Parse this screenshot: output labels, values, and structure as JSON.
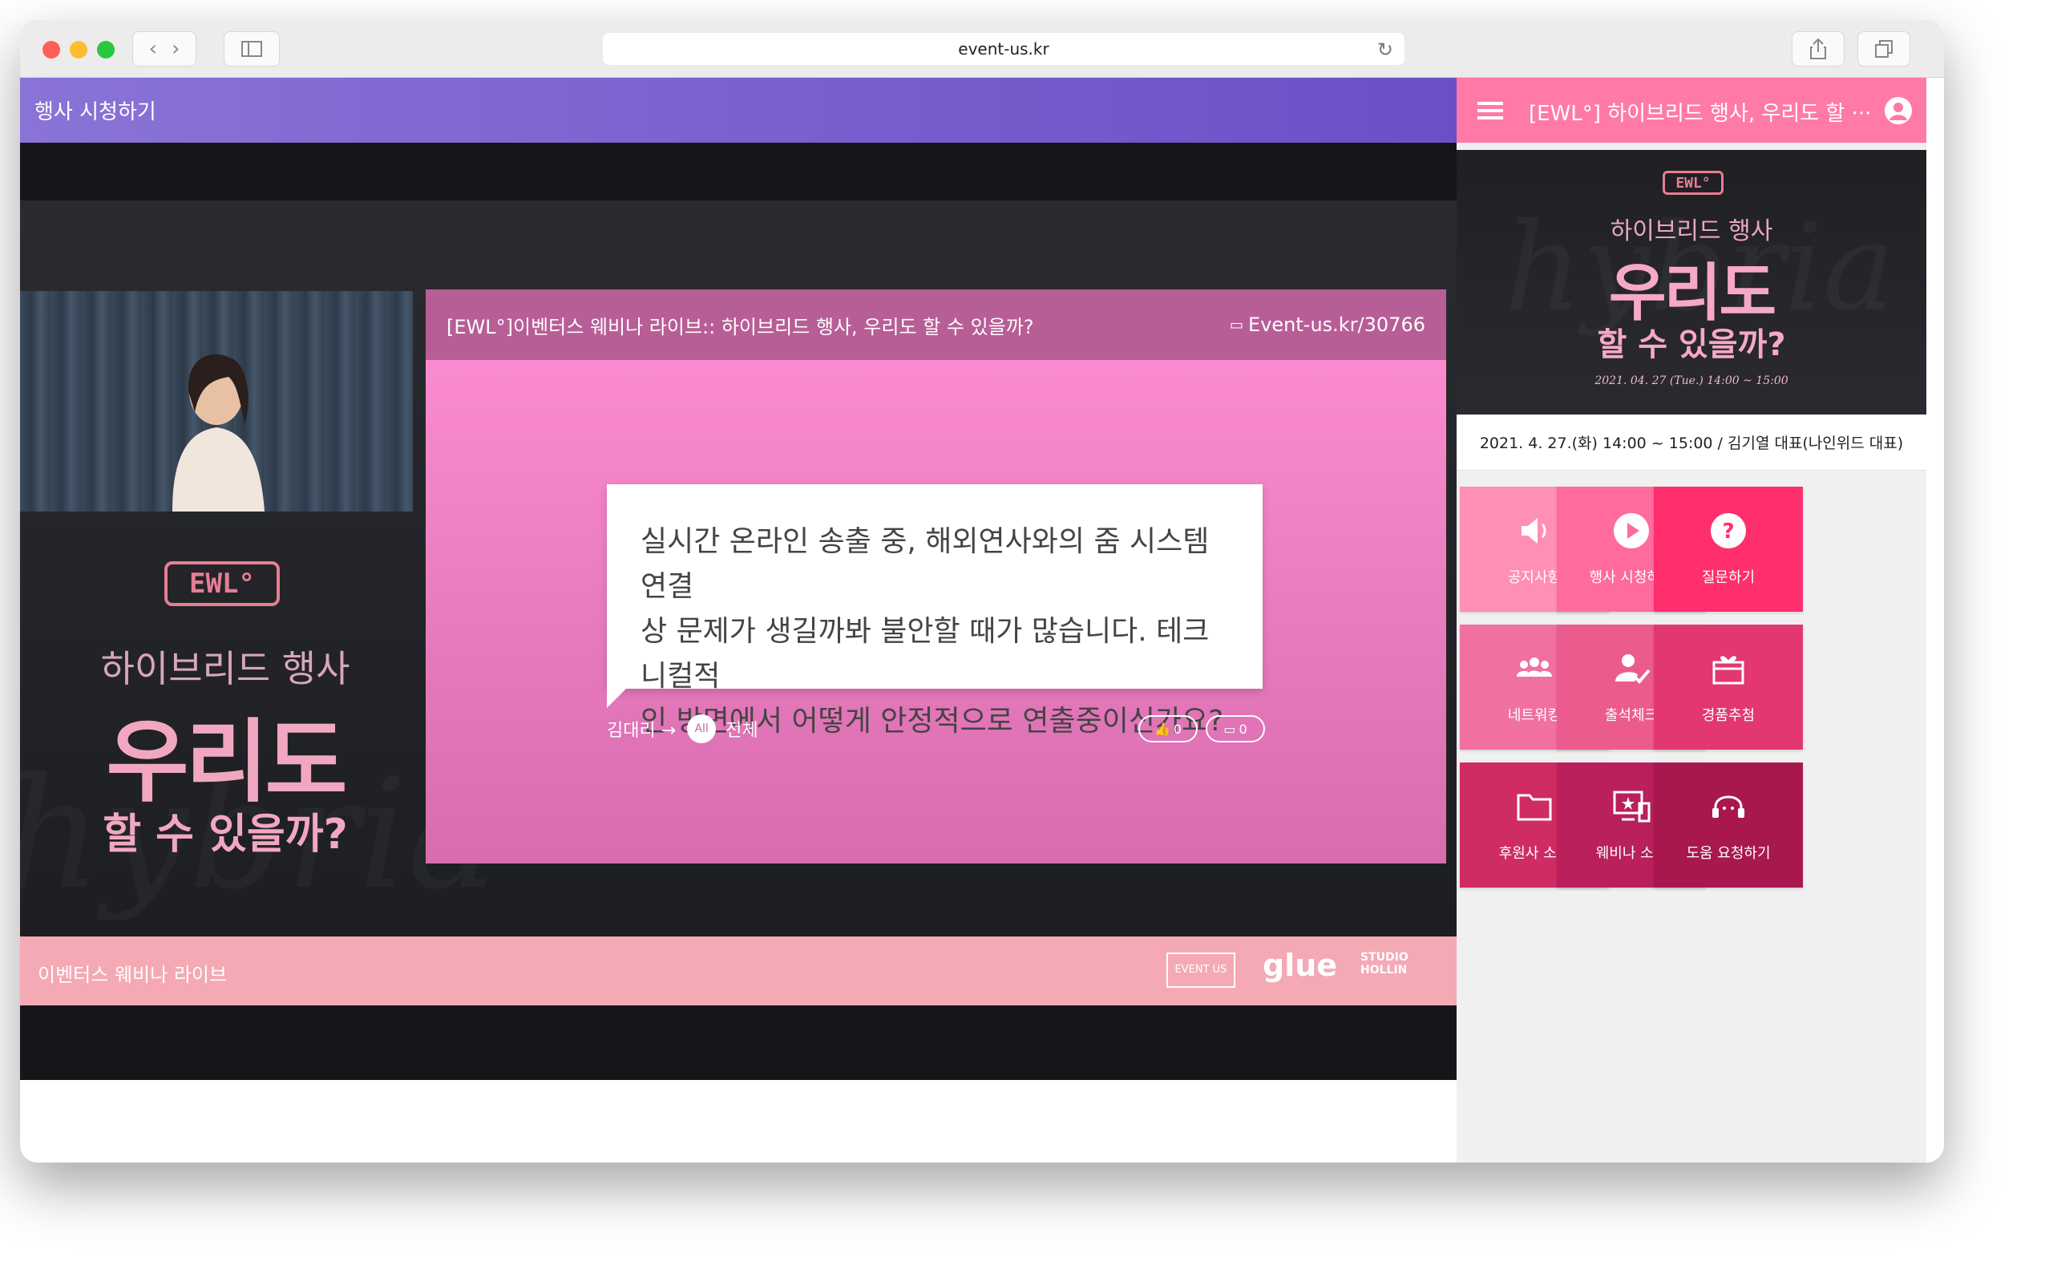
{
  "browser": {
    "url": "event-us.kr"
  },
  "main": {
    "header_title": "행사 시청하기",
    "slide": {
      "title": "[EWL°]이벤터스 웨비나 라이브:: 하이브리드 행사, 우리도 할 수 있을까?",
      "url_label": "Event-us.kr/30766",
      "question_lines": [
        "실시간 온라인 송출 중, 해외연사와의 줌 시스템 연결",
        "상 문제가 생길까봐 불안할 때가 많습니다. 테크니컬적",
        "인 방면에서 어떻게 안정적으로 연출중이신가요?"
      ],
      "asker": "김대리 →",
      "target_badge": "All",
      "target_label": "전체",
      "likes": "0",
      "comments": "0"
    },
    "left_panel": {
      "logo": "EWL°",
      "sub": "하이브리드 행사",
      "big": "우리도",
      "question": "할 수 있을까?"
    },
    "lower_bar": {
      "title": "이벤터스 웨비나 라이브",
      "partner_1": "EVENT US",
      "partner_2": "glue",
      "partner_3": "STUDIO HOLLIN"
    }
  },
  "sidebar": {
    "title": "[EWL°] 하이브리드 행사, 우리도 할 ···",
    "banner": {
      "logo": "EWL°",
      "sub": "하이브리드 행사",
      "big": "우리도",
      "question": "할 수 있을까?",
      "date": "2021. 04. 27 (Tue.) 14:00 ~ 15:00"
    },
    "event_info": "2021. 4. 27.(화) 14:00 ~ 15:00 / 김기열 대표(나인위드 대표)",
    "tiles": [
      {
        "label": "공지사항",
        "icon": "megaphone-icon",
        "color": "#ff8fb3"
      },
      {
        "label": "행사 시청하기",
        "icon": "play-icon",
        "color": "#ff6b9d"
      },
      {
        "label": "질문하기",
        "icon": "question-icon",
        "color": "#ff2f6e"
      },
      {
        "label": "네트워킹",
        "icon": "people-icon",
        "color": "#f0709f"
      },
      {
        "label": "출석체크",
        "icon": "user-check-icon",
        "color": "#ec5b8e"
      },
      {
        "label": "경품추첨",
        "icon": "gift-icon",
        "color": "#e2386f"
      },
      {
        "label": "후원사 소개",
        "icon": "folder-icon",
        "color": "#cf2c66"
      },
      {
        "label": "웨비나 소개",
        "icon": "webinar-icon",
        "color": "#b9205c"
      },
      {
        "label": "도움 요청하기",
        "icon": "headset-icon",
        "color": "#a8184f"
      }
    ]
  }
}
